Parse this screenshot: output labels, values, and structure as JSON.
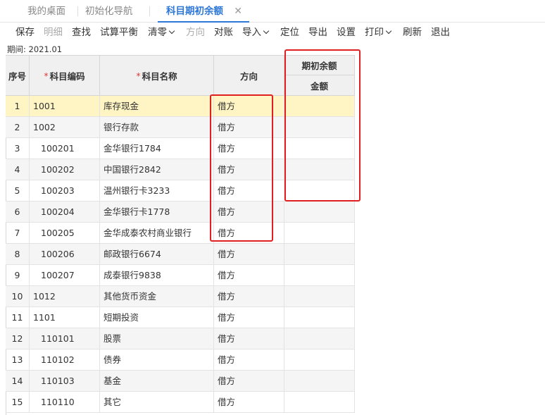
{
  "tabs": [
    {
      "label": "我的桌面"
    },
    {
      "label": "初始化导航"
    },
    {
      "label": "科目期初余额",
      "close": "✕"
    }
  ],
  "toolbar": [
    {
      "label": "保存"
    },
    {
      "label": "明细",
      "disabled": true
    },
    {
      "label": "查找"
    },
    {
      "label": "试算平衡"
    },
    {
      "label": "清零",
      "dropdown": true
    },
    {
      "label": "方向",
      "disabled": true
    },
    {
      "label": "对账"
    },
    {
      "label": "导入",
      "dropdown": true
    },
    {
      "label": "定位"
    },
    {
      "label": "导出"
    },
    {
      "label": "设置"
    },
    {
      "label": "打印",
      "dropdown": true
    },
    {
      "label": "刷新"
    },
    {
      "label": "退出"
    }
  ],
  "period": "期间: 2021.01",
  "grid": {
    "headers": {
      "seq": "序号",
      "code": "科目编码",
      "name": "科目名称",
      "direction": "方向",
      "opening_group": "期初余额",
      "amount": "金额",
      "required_mark": "*"
    },
    "rows": [
      {
        "seq": "1",
        "code": "1001",
        "name": "库存现金",
        "direction": "借方",
        "level": 1
      },
      {
        "seq": "2",
        "code": "1002",
        "name": "银行存款",
        "direction": "借方",
        "level": 1
      },
      {
        "seq": "3",
        "code": "100201",
        "name": "金华银行1784",
        "direction": "借方",
        "level": 2
      },
      {
        "seq": "4",
        "code": "100202",
        "name": "中国银行2842",
        "direction": "借方",
        "level": 2
      },
      {
        "seq": "5",
        "code": "100203",
        "name": "温州银行卡3233",
        "direction": "借方",
        "level": 2
      },
      {
        "seq": "6",
        "code": "100204",
        "name": "金华银行卡1778",
        "direction": "借方",
        "level": 2
      },
      {
        "seq": "7",
        "code": "100205",
        "name": "金华成泰农村商业银行",
        "direction": "借方",
        "level": 2
      },
      {
        "seq": "8",
        "code": "100206",
        "name": "邮政银行6674",
        "direction": "借方",
        "level": 2
      },
      {
        "seq": "9",
        "code": "100207",
        "name": "成泰银行9838",
        "direction": "借方",
        "level": 2
      },
      {
        "seq": "10",
        "code": "1012",
        "name": "其他货币资金",
        "direction": "借方",
        "level": 1
      },
      {
        "seq": "11",
        "code": "1101",
        "name": "短期投资",
        "direction": "借方",
        "level": 1
      },
      {
        "seq": "12",
        "code": "110101",
        "name": "股票",
        "direction": "借方",
        "level": 2
      },
      {
        "seq": "13",
        "code": "110102",
        "name": "债券",
        "direction": "借方",
        "level": 2
      },
      {
        "seq": "14",
        "code": "110103",
        "name": "基金",
        "direction": "借方",
        "level": 2
      },
      {
        "seq": "15",
        "code": "110110",
        "name": "其它",
        "direction": "借方",
        "level": 2
      }
    ]
  },
  "colors": {
    "accent": "#2d78d6",
    "selected_row": "#fff4c4",
    "annotation": "#e02020",
    "required": "#e53935"
  }
}
